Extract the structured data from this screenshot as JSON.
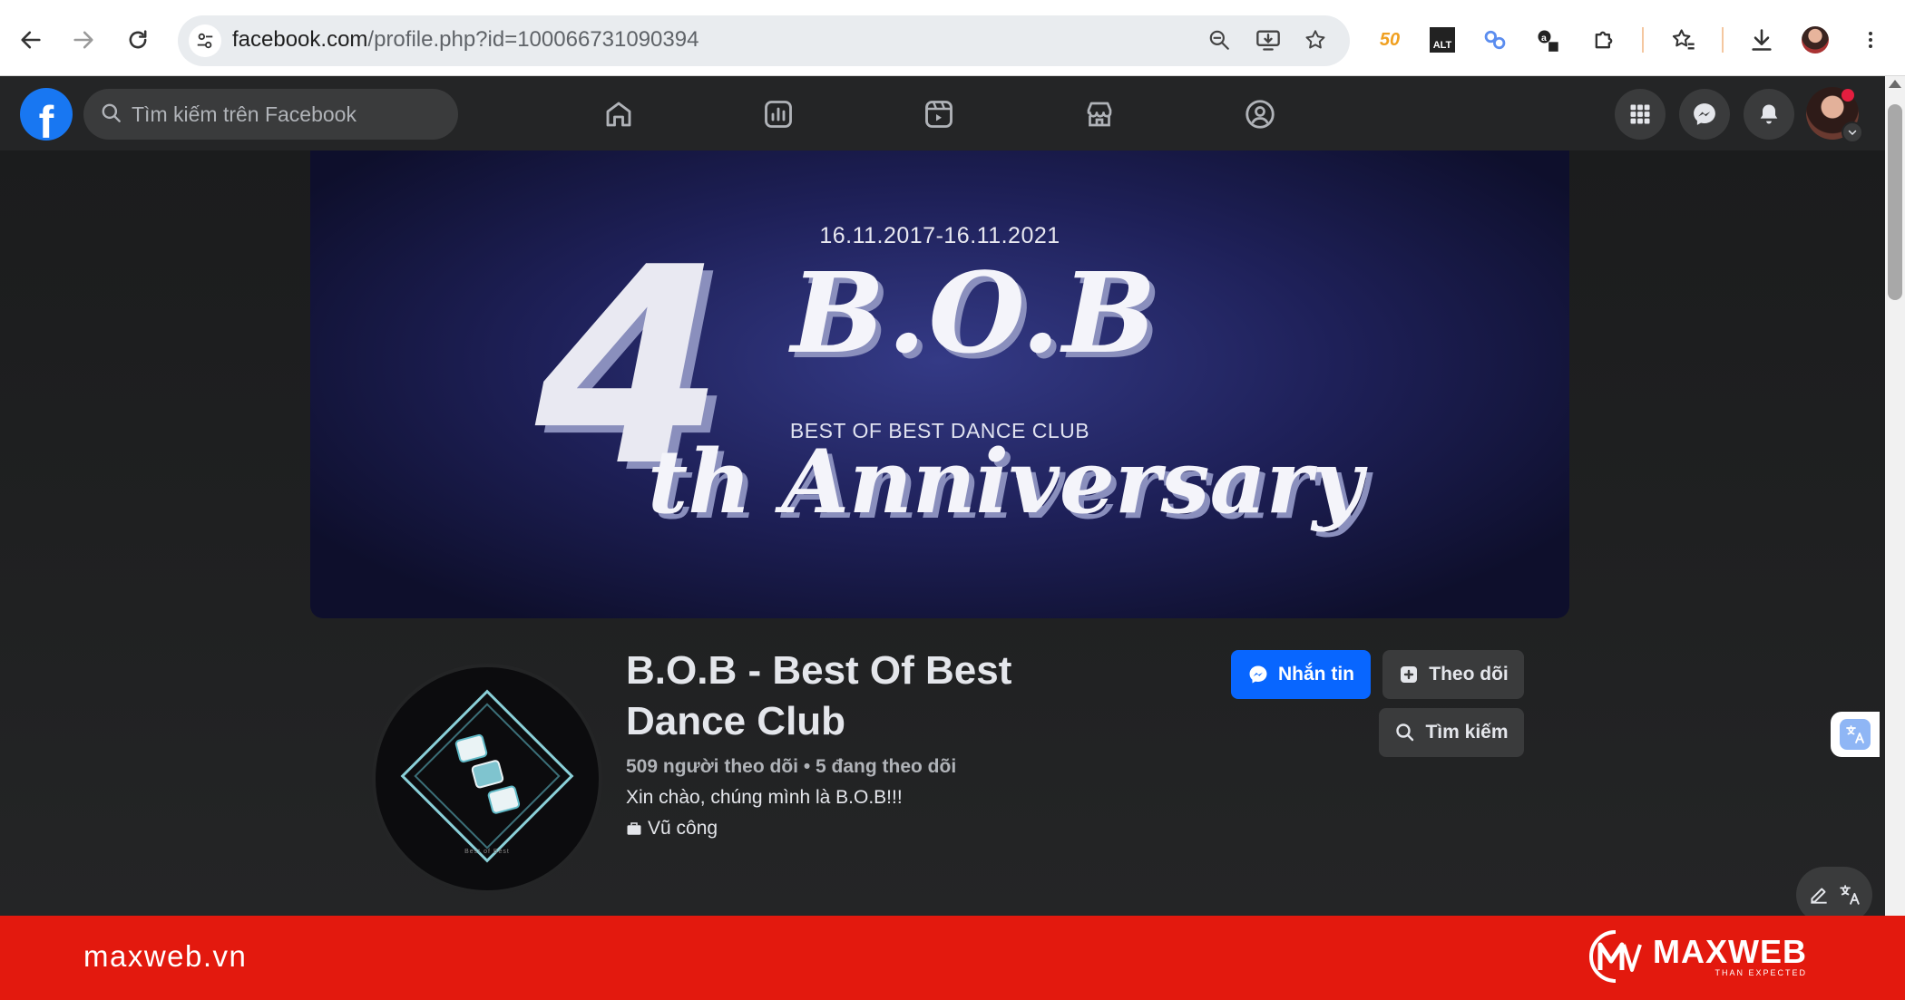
{
  "browser": {
    "url_host": "facebook.com",
    "url_path": "/profile.php?id=100066731090394",
    "extension_badge": "50",
    "alt_badge": "ALT"
  },
  "facebook": {
    "search_placeholder": "Tìm kiếm trên Facebook",
    "logo_letter": "f"
  },
  "cover": {
    "date_range": "16.11.2017-16.11.2021",
    "number": "4",
    "brand": "B.O.B",
    "subtitle": "BEST OF BEST DANCE CLUB",
    "anniversary": "th Anniversary"
  },
  "profile": {
    "name": "B.O.B - Best Of Best Dance Club",
    "stats": "509 người theo dõi • 5 đang theo dõi",
    "bio": "Xin chào, chúng mình là B.O.B!!!",
    "category": "Vũ công",
    "avatar_caption": "Best of Best"
  },
  "actions": {
    "message": "Nhắn tin",
    "follow": "Theo dõi",
    "search": "Tìm kiếm"
  },
  "footer": {
    "site": "maxweb.vn",
    "brand_name": "MAXWEB",
    "brand_tagline": "THAN EXPECTED"
  },
  "colors": {
    "fb_blue": "#1877f2",
    "message_button": "#0866ff",
    "footer_red": "#e3190e",
    "dark_surface": "#242526"
  }
}
